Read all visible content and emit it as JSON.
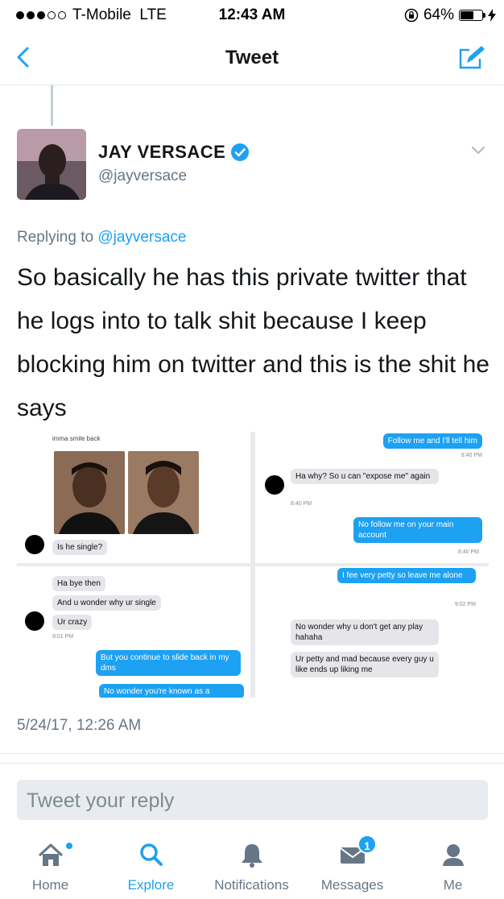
{
  "status_bar": {
    "carrier": "T-Mobile",
    "network": "LTE",
    "time": "12:43 AM",
    "battery": "64%",
    "battery_level": 0.64
  },
  "nav": {
    "title": "Tweet",
    "back_icon": "chevron-left-icon",
    "compose_icon": "compose-icon"
  },
  "tweet": {
    "author_name": "JAY VERSACE",
    "verified": true,
    "handle": "@jayversace",
    "replying_prefix": "Replying to",
    "replying_to": "@jayversace",
    "text": "So basically he has this private twitter that he logs into to talk shit because I keep blocking him on twitter and this is the shit he says",
    "timestamp": "5/24/17, 12:26 AM"
  },
  "media": {
    "tile1": {
      "caption": "imma smile back",
      "msg": "Is he single?"
    },
    "tile2": {
      "msg1": "Follow me and I'll tell him",
      "time1": "8:40 PM",
      "msg2": "Ha why? So u can \"expose me\" again",
      "time2": "8:40 PM",
      "msg3": "No follow me on your main account",
      "time3": "8:40 PM"
    },
    "tile3": {
      "msg1": "Ha bye then",
      "msg2": "And u wonder why ur single",
      "msg3": "Ur crazy",
      "time1": "9:01 PM",
      "msg4": "But you continue to slide back in my dms",
      "msg5": "No wonder you're known as a"
    },
    "tile4": {
      "msg1": "I fee very petty so leave me alone",
      "time1": "9:02 PM",
      "msg2": "No wonder why u don't get any play hahaha",
      "msg3": "Ur petty and mad because every guy u like ends up liking me"
    }
  },
  "reply": {
    "placeholder": "Tweet your reply"
  },
  "tabbar": {
    "items": [
      {
        "label": "Home",
        "icon": "home-icon"
      },
      {
        "label": "Explore",
        "icon": "search-icon"
      },
      {
        "label": "Notifications",
        "icon": "bell-icon"
      },
      {
        "label": "Messages",
        "icon": "envelope-icon",
        "badge": "1"
      },
      {
        "label": "Me",
        "icon": "person-icon"
      }
    ],
    "active": "Explore"
  },
  "colors": {
    "accent": "#1da1f2",
    "secondary_text": "#657786",
    "primary_text": "#14171a"
  }
}
